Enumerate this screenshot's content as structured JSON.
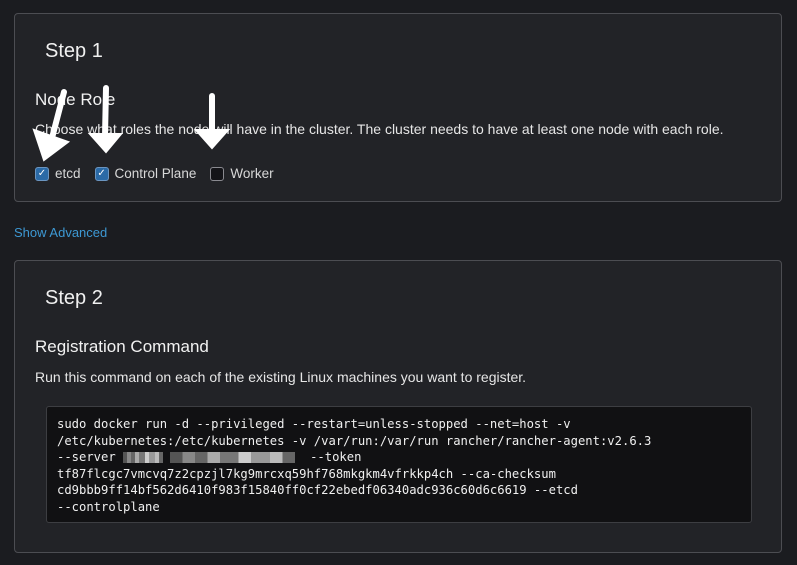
{
  "step1": {
    "title": "Step 1",
    "heading": "Node Role",
    "description": "Choose what roles the node will have in the cluster. The cluster needs to have at least one node with each role.",
    "roles": [
      {
        "label": "etcd",
        "checked": true
      },
      {
        "label": "Control Plane",
        "checked": true
      },
      {
        "label": "Worker",
        "checked": false
      }
    ]
  },
  "show_advanced": "Show Advanced",
  "step2": {
    "title": "Step 2",
    "heading": "Registration Command",
    "description": "Run this command on each of the existing Linux machines you want to register.",
    "command_lines": [
      "sudo docker run -d --privileged --restart=unless-stopped --net=host -v",
      "/etc/kubernetes:/etc/kubernetes -v /var/run:/var/run rancher/rancher-agent:v2.6.3",
      "--server",
      "--token",
      "tf87flcgc7vmcvq7z2cpzjl7kg9mrcxq59hf768mkgkm4vfrkkp4ch --ca-checksum",
      "cd9bbb9ff14bf562d6410f983f15840ff0cf22ebedf06340adc936c60d6c6619 --etcd",
      "--controlplane"
    ]
  }
}
